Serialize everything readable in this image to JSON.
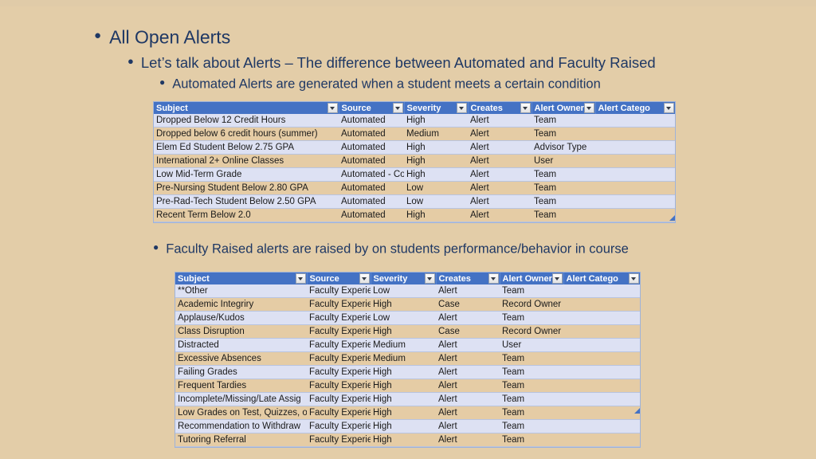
{
  "slide": {
    "background_color": "#E3CDA8",
    "text_color": "#1F3864",
    "bullets": [
      {
        "level": 1,
        "text": "All Open Alerts"
      },
      {
        "level": 2,
        "text": "Let’s talk about Alerts – The difference between Automated and Faculty Raised"
      },
      {
        "level": 3,
        "text": "Automated Alerts are generated when a student meets a certain condition"
      },
      {
        "level": 3,
        "text": "Faculty Raised alerts are raised by on students performance/behavior in course"
      }
    ]
  },
  "tables": {
    "header_color": "#4472C4",
    "row_color_odd": "#DDE1F3",
    "row_color_even": "#E5CCA5",
    "filter_icon": "chevron-down-icon",
    "automated": {
      "columns": [
        "Subject",
        "Source",
        "Severity",
        "Creates",
        "Alert Owner:",
        "Alert Catego"
      ],
      "rows": [
        [
          "Dropped Below 12 Credit Hours",
          "Automated",
          "High",
          "Alert",
          "Team",
          ""
        ],
        [
          "Dropped below 6 credit hours (summer)",
          "Automated",
          "Medium",
          "Alert",
          "Team",
          ""
        ],
        [
          "Elem Ed Student Below 2.75 GPA",
          "Automated",
          "High",
          "Alert",
          "Advisor Type",
          ""
        ],
        [
          "International 2+ Online Classes",
          "Automated",
          "High",
          "Alert",
          "User",
          ""
        ],
        [
          "Low Mid-Term Grade",
          "Automated - Co",
          "High",
          "Alert",
          "Team",
          ""
        ],
        [
          "Pre-Nursing Student Below 2.80 GPA",
          "Automated",
          "Low",
          "Alert",
          "Team",
          ""
        ],
        [
          "Pre-Rad-Tech Student Below 2.50 GPA",
          "Automated",
          "Low",
          "Alert",
          "Team",
          ""
        ],
        [
          "Recent Term Below 2.0",
          "Automated",
          "High",
          "Alert",
          "Team",
          ""
        ]
      ]
    },
    "faculty": {
      "columns": [
        "Subject",
        "Source",
        "Severity",
        "Creates",
        "Alert Owner:",
        "Alert Catego"
      ],
      "rows": [
        [
          "**Other",
          "Faculty Experie",
          "Low",
          "Alert",
          "Team",
          ""
        ],
        [
          "Academic Integriry",
          "Faculty Experie",
          "High",
          "Case",
          "Record Owner",
          ""
        ],
        [
          "Applause/Kudos",
          "Faculty Experie",
          "Low",
          "Alert",
          "Team",
          ""
        ],
        [
          "Class Disruption",
          "Faculty Experie",
          "High",
          "Case",
          "Record Owner",
          ""
        ],
        [
          "Distracted",
          "Faculty Experie",
          "Medium",
          "Alert",
          "User",
          ""
        ],
        [
          "Excessive Absences",
          "Faculty Experie",
          "Medium",
          "Alert",
          "Team",
          ""
        ],
        [
          "Failing Grades",
          "Faculty Experie",
          "High",
          "Alert",
          "Team",
          ""
        ],
        [
          "Frequent Tardies",
          "Faculty Experie",
          "High",
          "Alert",
          "Team",
          ""
        ],
        [
          "Incomplete/Missing/Late Assig",
          "Faculty Experie",
          "High",
          "Alert",
          "Team",
          ""
        ],
        [
          "Low Grades on Test, Quizzes, or",
          "Faculty Experie",
          "High",
          "Alert",
          "Team",
          ""
        ],
        [
          "Recommendation to Withdraw",
          "Faculty Experie",
          "High",
          "Alert",
          "Team",
          ""
        ],
        [
          "Tutoring Referral",
          "Faculty Experie",
          "High",
          "Alert",
          "Team",
          ""
        ]
      ]
    }
  }
}
